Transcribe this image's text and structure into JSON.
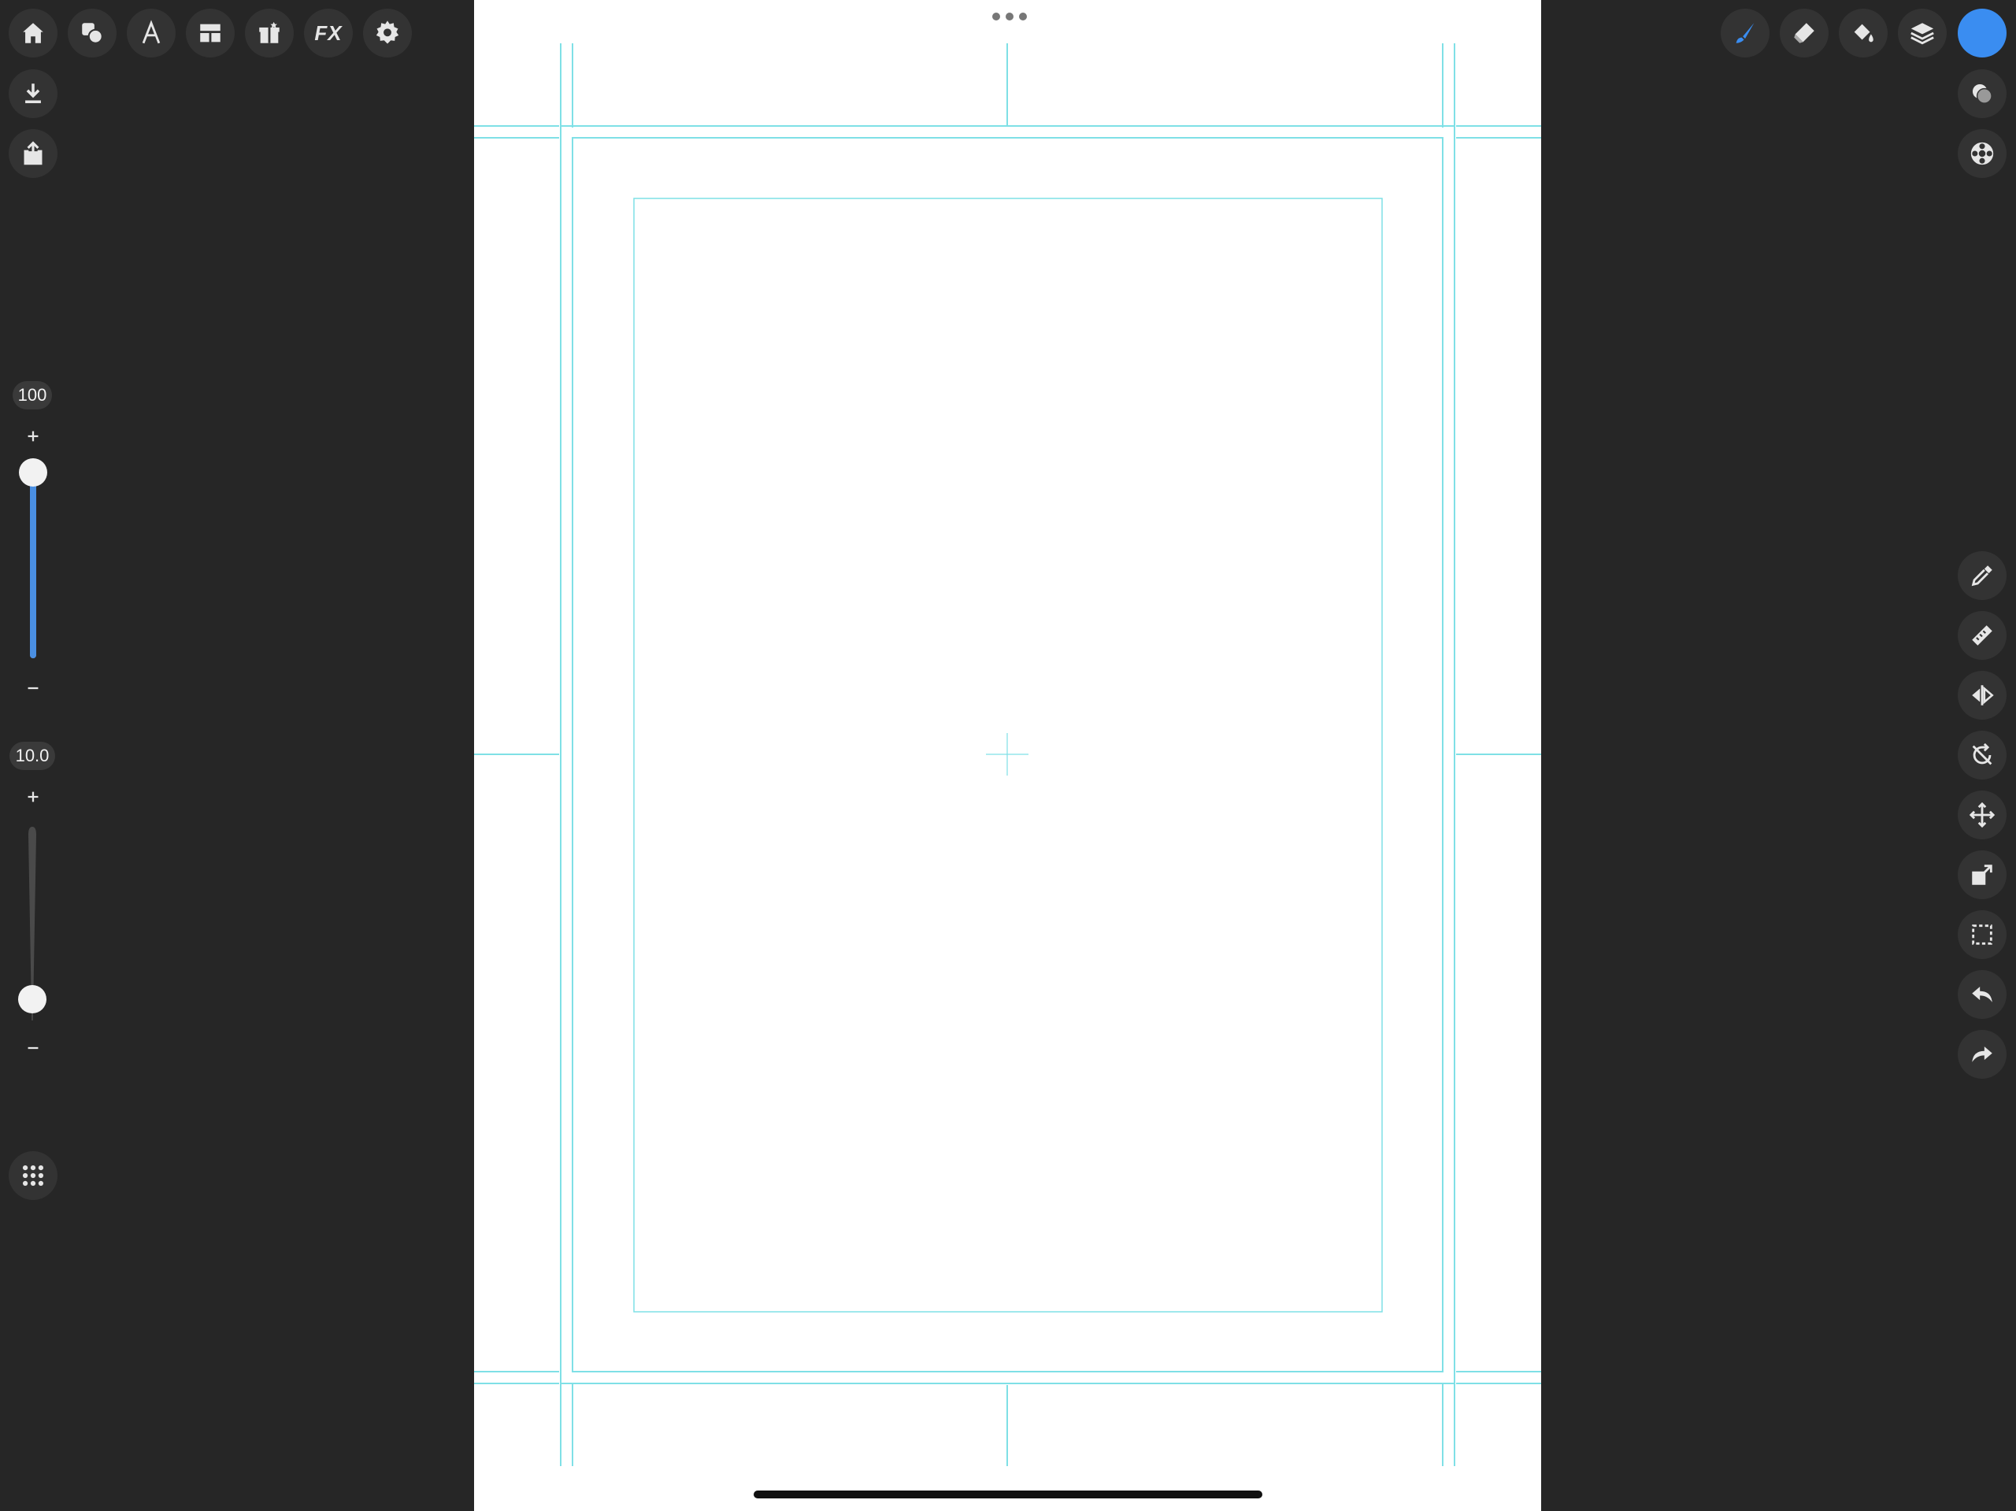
{
  "left_toolbar": {
    "top_buttons": [
      {
        "name": "home-icon"
      },
      {
        "name": "shapes-icon"
      },
      {
        "name": "text-icon"
      },
      {
        "name": "layout-icon"
      },
      {
        "name": "gift-icon"
      },
      {
        "name": "fx-icon",
        "label": "FX"
      },
      {
        "name": "gear-icon"
      }
    ],
    "download_icon": "download-icon",
    "share_icon": "share-icon",
    "opacity": {
      "value": "100",
      "level": 1.0
    },
    "size": {
      "value": "10.0",
      "level": 0.1
    },
    "grid_icon": "grid-icon"
  },
  "right_toolbar": {
    "tools": [
      "brush-icon",
      "eraser-icon",
      "fill-bucket-icon",
      "layers-icon"
    ],
    "color_swatch": "#3a8df1",
    "secondary": [
      "blend-icon",
      "color-wheel-icon"
    ],
    "side_tools": [
      "eyedropper-icon",
      "ruler-icon",
      "mirror-icon",
      "rotation-lock-icon",
      "move-icon",
      "resize-icon",
      "selection-icon",
      "undo-icon",
      "redo-icon"
    ]
  },
  "canvas": {
    "background": "#ffffff",
    "guide_color": "#7fe0e6"
  }
}
